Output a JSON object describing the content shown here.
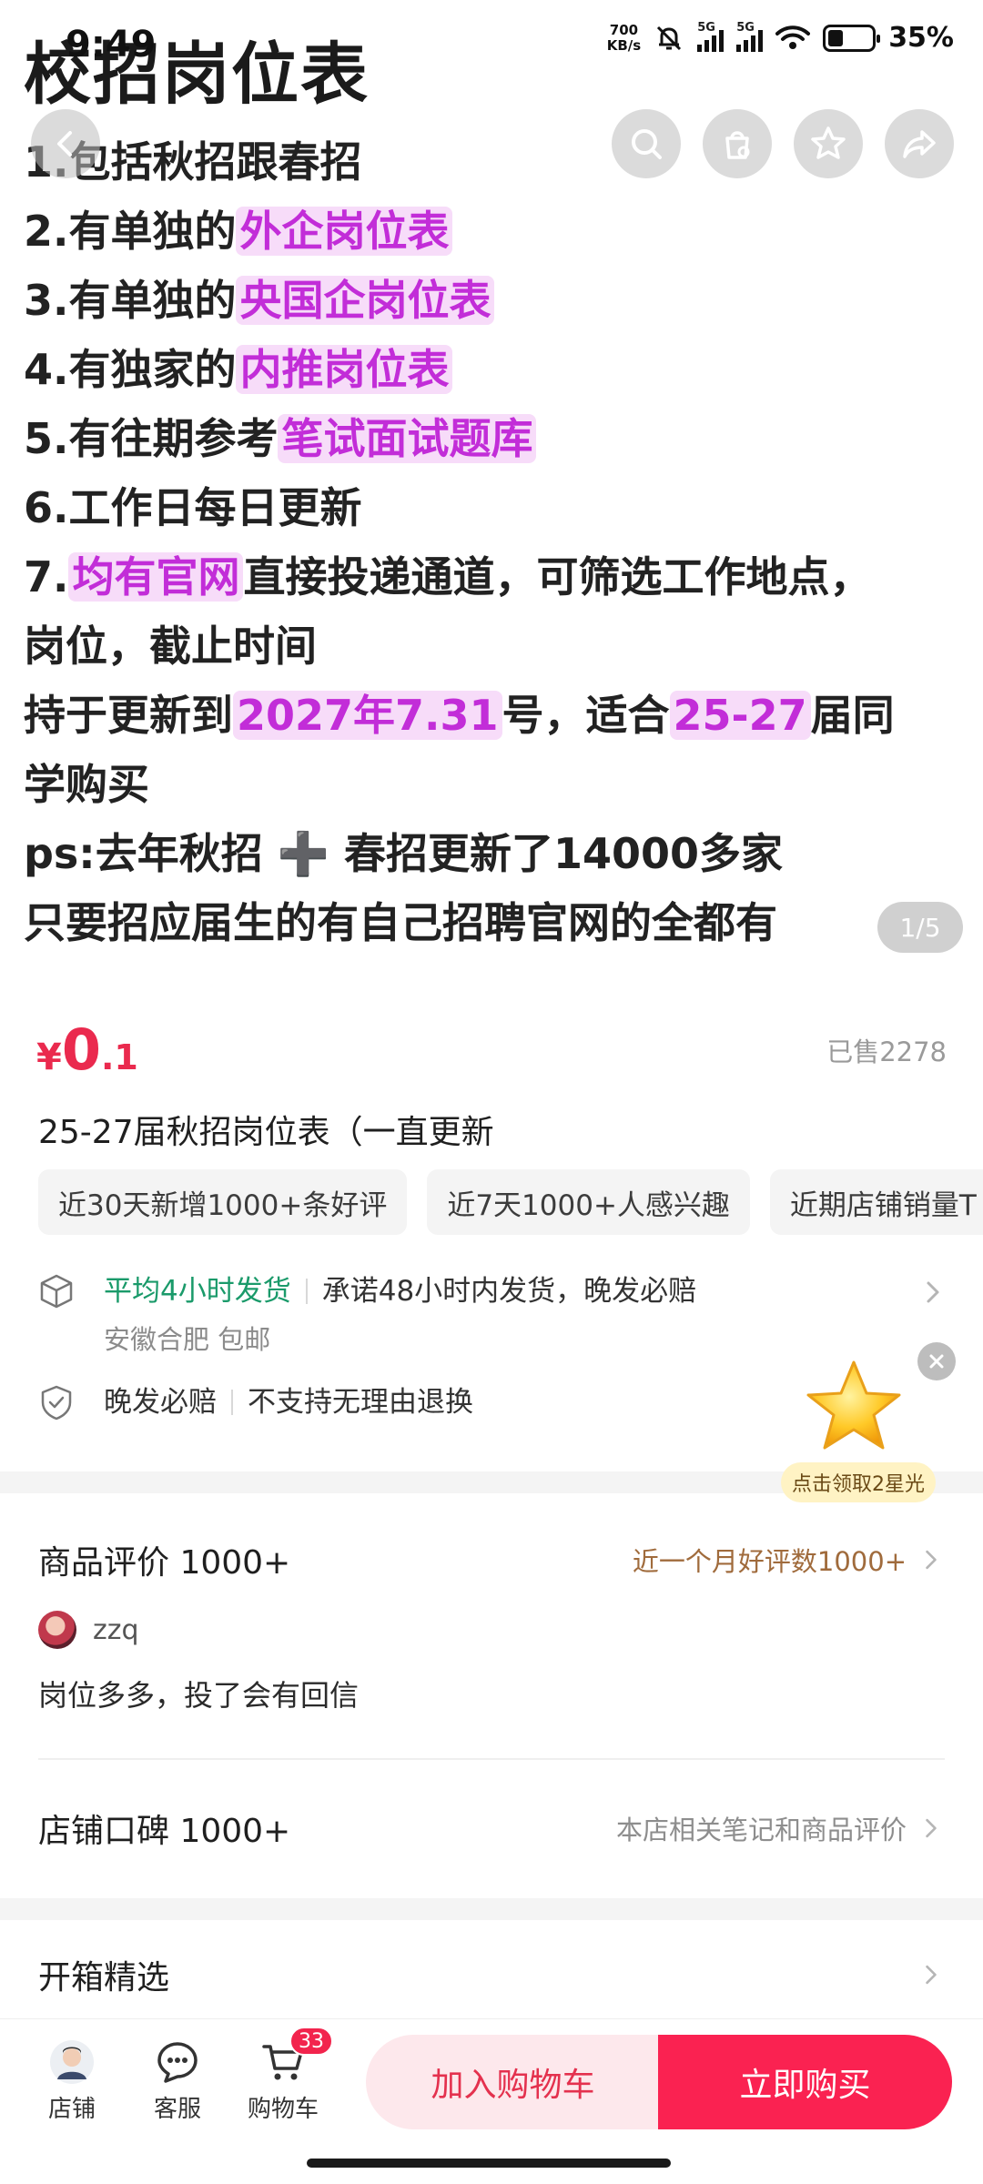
{
  "status_bar": {
    "time": "9:49",
    "net_speed_value": "700",
    "net_speed_unit": "KB/s",
    "signal1": "5G",
    "signal2": "5G",
    "battery": "35%",
    "battery_level": 0.35
  },
  "gallery": {
    "title": "校招岗位表",
    "lines": [
      [
        {
          "t": "1.包括秋招跟春招"
        }
      ],
      [
        {
          "t": "2.有单独的"
        },
        {
          "t": "外企岗位表",
          "hl": true
        }
      ],
      [
        {
          "t": "3.有单独的"
        },
        {
          "t": "央国企岗位表",
          "hl": true
        }
      ],
      [
        {
          "t": "4.有独家的"
        },
        {
          "t": "内推岗位表",
          "hl": true
        }
      ],
      [
        {
          "t": "5.有往期参考"
        },
        {
          "t": "笔试面试题库",
          "hl": true
        }
      ],
      [
        {
          "t": "6.工作日每日更新"
        }
      ],
      [
        {
          "t": "7."
        },
        {
          "t": "均有官网",
          "hl": true
        },
        {
          "t": "直接投递通道，可筛选工作地点，"
        }
      ],
      [
        {
          "t": "岗位，截止时间"
        }
      ],
      [
        {
          "t": "持于更新到"
        },
        {
          "t": "2027年7.31",
          "hl": true
        },
        {
          "t": "号，适合"
        },
        {
          "t": "25-27",
          "hl": true
        },
        {
          "t": "届同"
        }
      ],
      [
        {
          "t": "学购买"
        }
      ],
      [
        {
          "t": "ps:去年秋招 ➕ 春招更新了14000多家"
        }
      ],
      [
        {
          "t": "只要招应届生的有自己招聘官网的全都有"
        }
      ]
    ],
    "page_indicator": "1/5"
  },
  "nav_icons": [
    "back-icon",
    "search-icon",
    "bag-icon",
    "star-icon",
    "share-icon"
  ],
  "product": {
    "price_currency": "¥",
    "price_int": "0",
    "price_dec": ".1",
    "sold": "已售2278",
    "title": "25-27届秋招岗位表（一直更新",
    "tags": [
      "近30天新增1000+条好评",
      "近7天1000+人感兴趣",
      "近期店铺销量T"
    ]
  },
  "shipping": {
    "highlight": "平均4小时发货",
    "promise": "承诺48小时内发货，晚发必赔",
    "location": "安徽合肥 包邮"
  },
  "guarantee": {
    "item1": "晚发必赔",
    "item2": "不支持无理由退换"
  },
  "promo": {
    "badge": "点击领取2星光"
  },
  "reviews": {
    "title": "商品评价 1000+",
    "right": "近一个月好评数1000+",
    "reviewer": "zzq",
    "text": "岗位多多，投了会有回信"
  },
  "store_rating": {
    "title": "店铺口碑 1000+",
    "right": "本店相关笔记和商品评价"
  },
  "unboxing": {
    "title": "开箱精选"
  },
  "bottom_bar": {
    "store": "店铺",
    "service": "客服",
    "cart": "购物车",
    "cart_count": "33",
    "add_to_cart": "加入购物车",
    "buy_now": "立即购买"
  },
  "colors": {
    "accent": "#fa2251",
    "price": "#ea2a4e",
    "highlight_text": "#c22dd8",
    "highlight_bg": "#f7dcf9",
    "shipping_green": "#1a9a6a"
  }
}
